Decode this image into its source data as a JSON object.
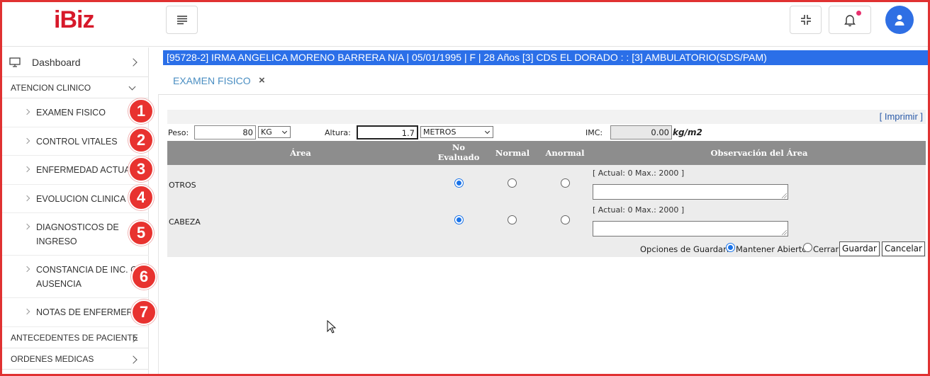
{
  "header": {
    "logo_text": "iBiz",
    "brand_color": "#d7192a",
    "menu_icon": "hamburger-icon",
    "collapse_icon": "compress-icon",
    "notification_icon": "bell-icon",
    "avatar_icon": "user-icon"
  },
  "sidebar": {
    "dashboard_label": "Dashboard",
    "sections": [
      {
        "label": "ATENCION CLINICO"
      },
      {
        "label": "ANTECEDENTES DE PACIENTE"
      },
      {
        "label": "ORDENES MEDICAS"
      }
    ],
    "items": [
      {
        "label": "EXAMEN FISICO",
        "badge": "1"
      },
      {
        "label": "CONTROL VITALES",
        "badge": "2"
      },
      {
        "label": "ENFERMEDAD ACTUAL",
        "badge": "3"
      },
      {
        "label": "EVOLUCION CLINICA",
        "badge": "4"
      },
      {
        "label": "DIAGNOSTICOS DE INGRESO",
        "badge": "5"
      },
      {
        "label": "CONSTANCIA DE INC. O AUSENCIA",
        "badge": "6"
      },
      {
        "label": "NOTAS DE ENFERMERA",
        "badge": "7"
      }
    ]
  },
  "patient_bar": "[95728-2] IRMA ANGELICA MORENO BARRERA N/A | 05/01/1995 | F | 28 Años   [3] CDS EL DORADO   : :   [3] AMBULATORIO(SDS/PAM)",
  "tab": {
    "label": "EXAMEN FISICO",
    "close": "×"
  },
  "form": {
    "imprimir": "[ Imprimir ]",
    "peso_label": "Peso:",
    "peso_value": "80",
    "peso_unit": "KG",
    "altura_label": "Altura:",
    "altura_value": "1.7",
    "altura_unit": "METROS",
    "imc_label": "IMC:",
    "imc_value": "0.00",
    "imc_unit": "kg/m2"
  },
  "table": {
    "headers": {
      "area": "Área",
      "no_evaluado": "No Evaluado",
      "normal": "Normal",
      "anormal": "Anormal",
      "observacion": "Observación del Área"
    },
    "rows": [
      {
        "area": "OTROS",
        "selected": "no_evaluado",
        "counter": "[ Actual: 0   Max.: 2000 ]"
      },
      {
        "area": "CABEZA",
        "selected": "no_evaluado",
        "counter": "[ Actual: 0   Max.: 2000 ]"
      }
    ]
  },
  "save_options": {
    "label": "Opciones de Guardar:",
    "keep_open": "Mantener Abierto",
    "close": "Cerrar",
    "selected": "keep_open",
    "save_button": "Guardar",
    "cancel_button": "Cancelar"
  }
}
